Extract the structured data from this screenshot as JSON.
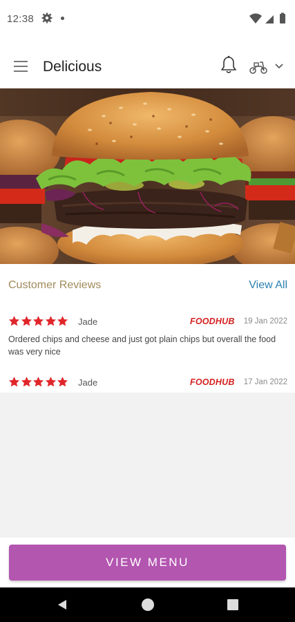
{
  "status_bar": {
    "time": "12:38",
    "icons": [
      "gear-icon",
      "dot-icon",
      "wifi-icon",
      "signal-icon",
      "battery-icon"
    ]
  },
  "app_bar": {
    "title": "Delicious",
    "icons": [
      "hamburger-menu-icon",
      "bell-icon",
      "scooter-icon",
      "chevron-down-icon"
    ]
  },
  "hero": {
    "image": "burger-photo"
  },
  "reviews": {
    "title": "Customer Reviews",
    "view_all_label": "View All",
    "items": [
      {
        "rating": 5,
        "reviewer": "Jade",
        "source": "FOODHUB",
        "date": "19 Jan 2022",
        "text": "Ordered chips and cheese and just got plain chips but overall the food was very nice"
      },
      {
        "rating": 5,
        "reviewer": "Jade",
        "source": "FOODHUB",
        "date": "17 Jan 2022",
        "text": ""
      }
    ]
  },
  "cta": {
    "view_menu_label": "VIEW MENU"
  },
  "colors": {
    "accent": "#b356b0",
    "star": "#e0262b",
    "link": "#2a7fb0",
    "reviews_title": "#a08a5a",
    "source_badge": "#d42020"
  },
  "nav_bar": {
    "icons": [
      "back-icon",
      "home-icon",
      "recents-icon"
    ]
  }
}
